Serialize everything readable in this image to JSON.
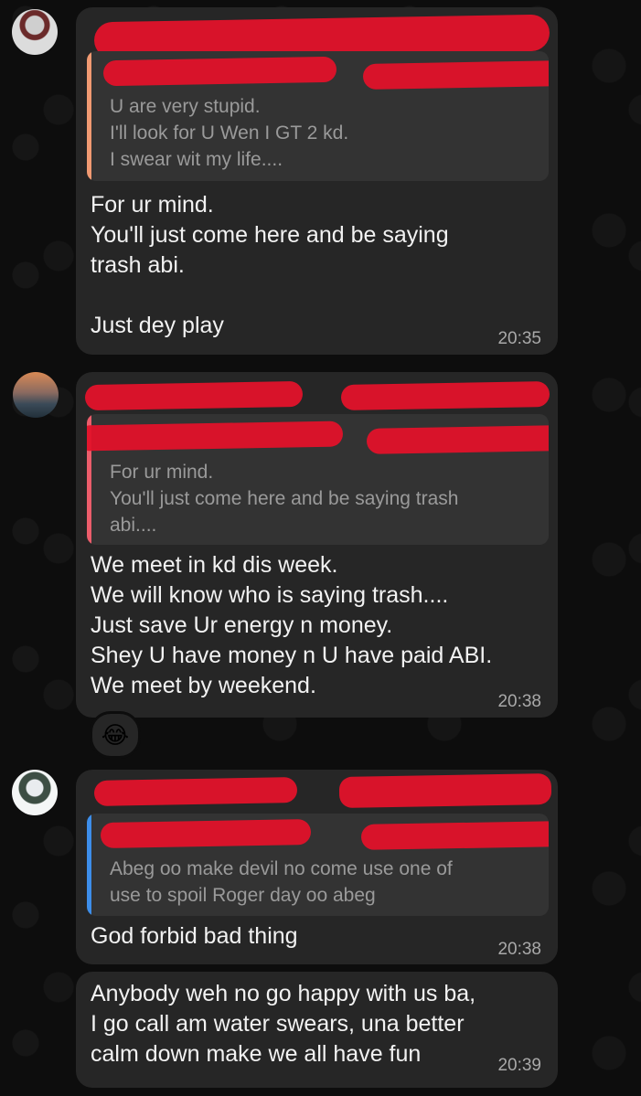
{
  "messages": [
    {
      "quote_text": "U are very stupid.\nI'll look for U Wen I GT 2 kd.\nI swear wit my life....",
      "quote_color": "#f19a72",
      "text": "For ur mind.\nYou'll just come here and be saying\ntrash abi.\n\nJust dey play",
      "time": "20:35"
    },
    {
      "quote_text": "For ur mind.\nYou'll just come here and be saying trash\nabi....",
      "quote_color": "#ec5d6b",
      "text": "We meet in kd dis week.\nWe will know who is saying trash....\nJust save Ur energy n money.\nShey U have money n U have paid ABI.\nWe meet by weekend.",
      "time": "20:38",
      "reaction": "😂"
    },
    {
      "quote_text": "Abeg oo make devil no come use one of\nuse to spoil Roger day oo abeg",
      "quote_color": "#3d8eea",
      "text": "God forbid bad thing",
      "time": "20:38"
    },
    {
      "text": "Anybody weh no go happy with us ba,\nI go call am water swears, una better\ncalm down make we all have fun",
      "time": "20:39"
    }
  ],
  "colors": {
    "background": "#0d0d0d",
    "bubble": "#262626",
    "quote_bg": "#333333",
    "redaction": "#e2122a"
  }
}
